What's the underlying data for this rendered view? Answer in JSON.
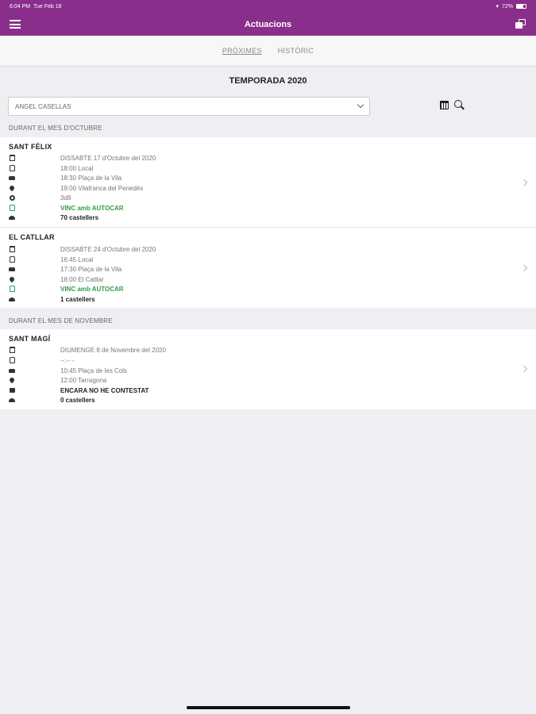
{
  "status_bar": {
    "time": "6:04 PM",
    "date": "Tue Feb 18",
    "battery": "72%"
  },
  "nav": {
    "title": "Actuacions"
  },
  "tabs": [
    {
      "label": "PRÒXIMES",
      "active": true
    },
    {
      "label": "HISTÒRIC",
      "active": false
    }
  ],
  "season_title": "TEMPORADA 2020",
  "member_select": {
    "value": "ANGEL CASELLAS"
  },
  "sections": [
    {
      "header": "DURANT EL MES D'OCTUBRE",
      "events": [
        {
          "name": "SANT FÈLIX",
          "rows": [
            {
              "icon": "calendar-icon",
              "text": "DISSABTE 17 d'Octubre del 2020"
            },
            {
              "icon": "bus-icon",
              "text": "18:00 Local"
            },
            {
              "icon": "car-icon",
              "text": "18:30 Plaça de la Vila"
            },
            {
              "icon": "location-pin-icon",
              "text": "19:00 Vilafranca del Penedès"
            },
            {
              "icon": "gear-icon",
              "text": "3d8"
            },
            {
              "icon": "bus-icon",
              "text": "VINC amb AUTOCAR",
              "style": "green"
            },
            {
              "icon": "users-icon",
              "text": "70 castellers",
              "style": "bold"
            }
          ]
        },
        {
          "name": "EL CATLLAR",
          "rows": [
            {
              "icon": "calendar-icon",
              "text": "DISSABTE 24 d'Octubre del 2020"
            },
            {
              "icon": "bus-icon",
              "text": "16:45 Local"
            },
            {
              "icon": "car-icon",
              "text": "17:30 Plaça de la Vila"
            },
            {
              "icon": "location-pin-icon",
              "text": "18:00 El Catllar"
            },
            {
              "icon": "bus-icon",
              "text": "VINC amb AUTOCAR",
              "style": "green"
            },
            {
              "icon": "users-icon",
              "text": "1 castellers",
              "style": "bold"
            }
          ]
        }
      ]
    },
    {
      "header": "DURANT EL MES DE NOVEMBRE",
      "events": [
        {
          "name": "SANT MAGÍ",
          "rows": [
            {
              "icon": "calendar-icon",
              "text": "DIUMENGE 8 de Novembre del 2020"
            },
            {
              "icon": "bus-icon",
              "text": "--:-- -"
            },
            {
              "icon": "car-icon",
              "text": "10:45 Plaça de les Cols"
            },
            {
              "icon": "location-pin-icon",
              "text": "12:00 Tarragona"
            },
            {
              "icon": "lock-icon",
              "text": "ENCARA NO HE CONTESTAT",
              "style": "bold"
            },
            {
              "icon": "users-icon",
              "text": "0 castellers",
              "style": "bold"
            }
          ]
        }
      ]
    }
  ],
  "colors": {
    "brand": "#8a2e8c",
    "confirmed": "#2e9d4b",
    "background": "#efeef3"
  }
}
